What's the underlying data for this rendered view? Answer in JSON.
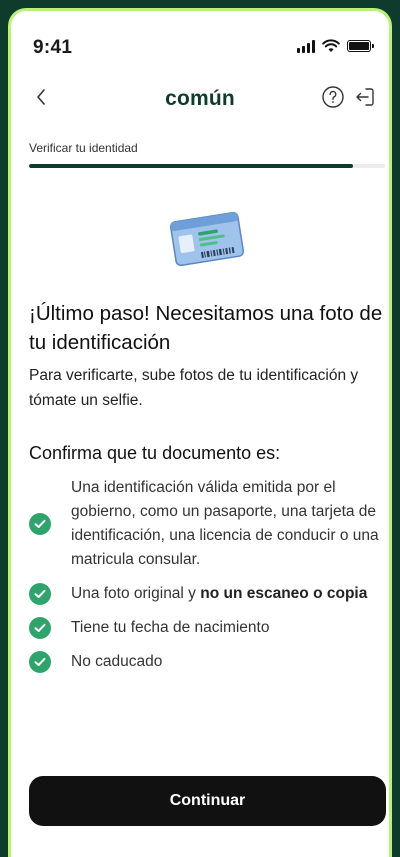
{
  "status_bar": {
    "time": "9:41"
  },
  "header": {
    "brand": "común"
  },
  "progress": {
    "label": "Verificar tu identidad",
    "fraction": 0.91
  },
  "content": {
    "title": "¡Último paso! Necesitamos una foto de tu identificación",
    "subtitle": "Para verificarte, sube fotos de tu identificación y tómate un selfie.",
    "section_title": "Confirma que tu documento es:",
    "items": [
      {
        "text": "Una identificación válida emitida por el gobierno, como un pasaporte, una tarjeta de identificación, una licencia de conducir o una matricula consular."
      },
      {
        "text": "Una foto original y ",
        "bold": "no un escaneo o copia"
      },
      {
        "text": "Tiene tu fecha de nacimiento"
      },
      {
        "text": "No caducado"
      }
    ]
  },
  "footer": {
    "cta_label": "Continuar"
  },
  "colors": {
    "brand": "#0f3b2c",
    "accent_border": "#b9f27a",
    "check": "#2ea36c",
    "button": "#111111"
  },
  "icons": [
    "back-chevron-icon",
    "help-icon",
    "exit-icon",
    "id-card-icon",
    "check-icon",
    "signal-icon",
    "wifi-icon",
    "battery-icon"
  ]
}
